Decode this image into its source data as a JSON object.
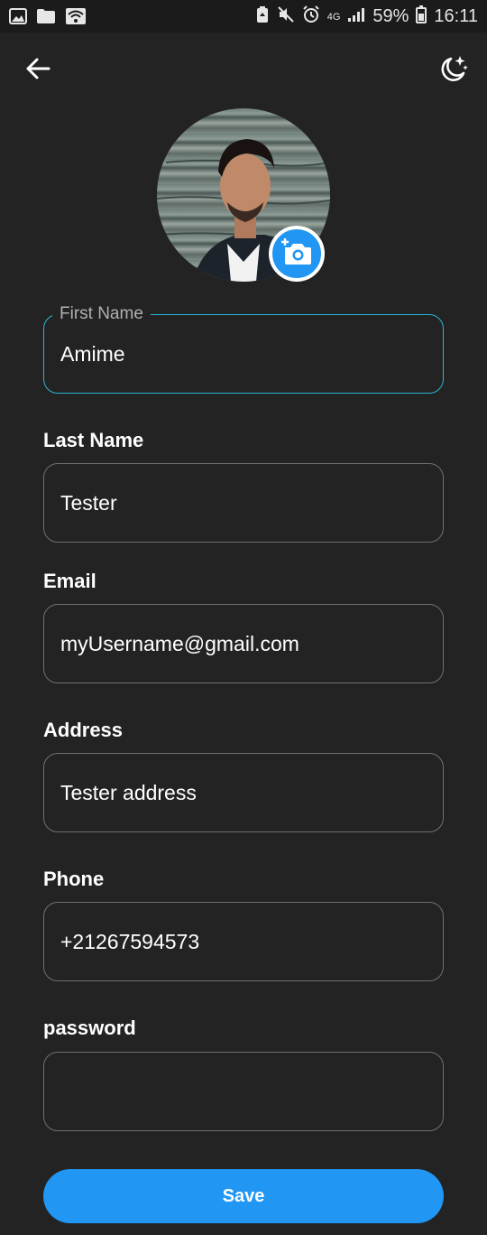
{
  "status_bar": {
    "network": "4G",
    "battery": "59%",
    "time": "16:11"
  },
  "form": {
    "first_name": {
      "label": "First Name",
      "value": "Amime"
    },
    "last_name": {
      "label": "Last Name",
      "value": "Tester"
    },
    "email": {
      "label": "Email",
      "value": "myUsername@gmail.com"
    },
    "address": {
      "label": "Address",
      "value": "Tester address"
    },
    "phone": {
      "label": "Phone",
      "value": "+21267594573"
    },
    "password": {
      "label": "password",
      "value": ""
    }
  },
  "save_label": "Save",
  "colors": {
    "background": "#232323",
    "accent": "#2196f3",
    "focus_border": "#29b6d6"
  },
  "icons": {
    "back": "arrow-left-icon",
    "theme": "moon-stars-icon",
    "camera": "add-photo-camera-icon"
  }
}
